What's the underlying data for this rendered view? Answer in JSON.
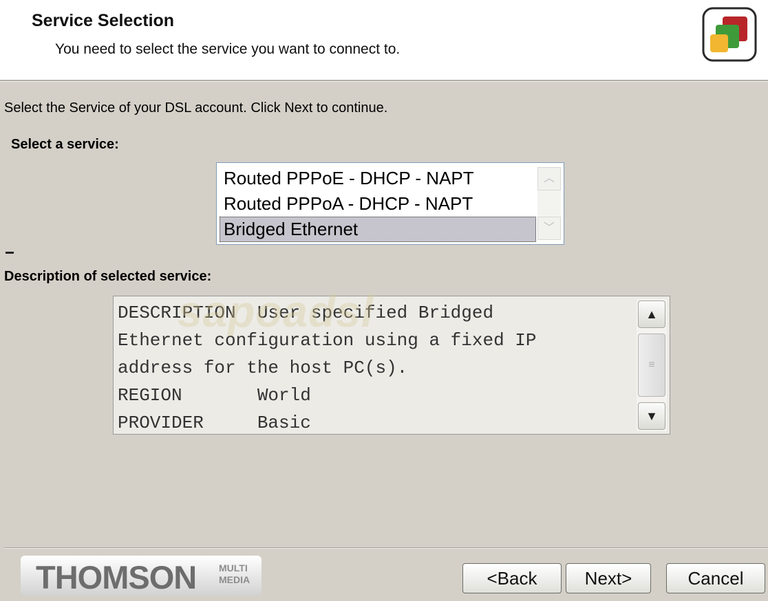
{
  "header": {
    "title": "Service Selection",
    "subtitle": "You need to select the service you want to connect to.",
    "logo_icon": "stacked-squares-logo-icon"
  },
  "instruction": "Select the Service of your DSL account. Click Next to continue.",
  "service_list": {
    "label": "Select a service:",
    "items": [
      {
        "label": "Routed PPPoE - DHCP - NAPT",
        "selected": false
      },
      {
        "label": "Routed PPPoA - DHCP - NAPT",
        "selected": false
      },
      {
        "label": "Bridged Ethernet",
        "selected": true
      }
    ]
  },
  "description": {
    "label": "Description of selected service:",
    "lines": [
      "DESCRIPTION  User specified Bridged",
      "Ethernet configuration using a fixed IP",
      "address for the host PC(s).",
      "REGION       World",
      "PROVIDER     Basic"
    ]
  },
  "watermark": "sapoadsl",
  "brand": {
    "name": "THOMSON",
    "tag": "MULTI MEDIA"
  },
  "buttons": {
    "back": "<Back",
    "next": "Next>",
    "cancel": "Cancel"
  },
  "colors": {
    "dialog_bg": "#d4d0c8",
    "header_bg": "#ffffff",
    "selection_bg": "#c6c4cc",
    "logo_red": "#b8262a",
    "logo_green": "#3f9a3a",
    "logo_yellow": "#f2b630"
  }
}
